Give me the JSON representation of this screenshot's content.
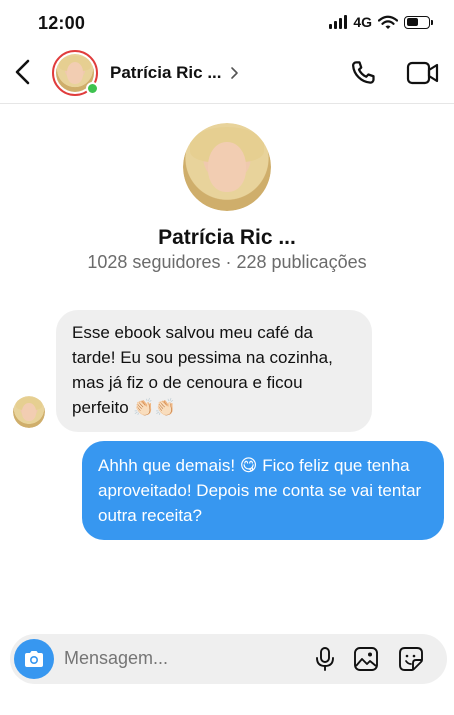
{
  "status_bar": {
    "time": "12:00",
    "network": "4G",
    "icons": [
      "signal-icon",
      "wifi-icon",
      "battery-icon"
    ]
  },
  "header": {
    "contact_name": "Patrícia Ric ...",
    "online": true,
    "icons": [
      "back-arrow-icon",
      "chevron-right-icon",
      "phone-icon",
      "video-camera-icon"
    ],
    "colors": {
      "story_ring": "#e03c3c",
      "online_dot": "#3ec24f"
    }
  },
  "profile": {
    "name": "Patrícia Ric ...",
    "stats": "1028 seguidores · 228 publicações"
  },
  "messages": [
    {
      "direction": "incoming",
      "text": "Esse ebook salvou meu café da tarde! Eu sou pessima na cozinha, mas já fiz o de cenoura e ficou perfeito 👏🏻👏🏻"
    },
    {
      "direction": "outgoing",
      "text": "Ahhh que demais! 😋 Fico feliz que tenha aproveitado! Depois me conta se vai tentar outra receita?"
    }
  ],
  "composer": {
    "placeholder": "Mensagem...",
    "icons": [
      "camera-icon",
      "microphone-icon",
      "gallery-icon",
      "sticker-icon"
    ]
  },
  "colors": {
    "accent": "#3797f0",
    "incoming_bubble": "#efefef",
    "outgoing_bubble": "#3797f0"
  }
}
